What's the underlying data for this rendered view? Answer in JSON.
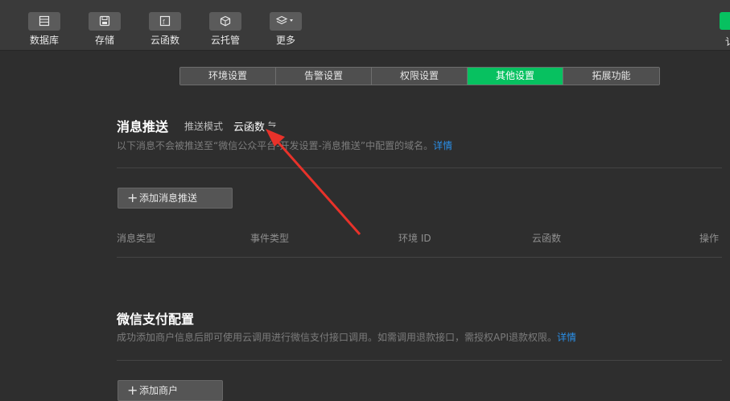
{
  "toolbar": {
    "items": [
      {
        "label": "数据库",
        "icon": "database-icon"
      },
      {
        "label": "存储",
        "icon": "storage-icon"
      },
      {
        "label": "云函数",
        "icon": "cloud-function-icon"
      },
      {
        "label": "云托管",
        "icon": "cloud-hosting-icon"
      },
      {
        "label": "更多",
        "icon": "more-layers-icon"
      }
    ],
    "edge_text": "讠"
  },
  "tabs": [
    {
      "label": "环境设置",
      "active": false
    },
    {
      "label": "告警设置",
      "active": false
    },
    {
      "label": "权限设置",
      "active": false
    },
    {
      "label": "其他设置",
      "active": true
    },
    {
      "label": "拓展功能",
      "active": false
    }
  ],
  "push": {
    "title": "消息推送",
    "mode_label": "推送模式",
    "mode_value": "云函数",
    "switch_glyph": "⇋",
    "desc": "以下消息不会被推送至“微信公众平台-开发设置-消息推送”中配置的域名。",
    "detail_link": "详情",
    "add_button": "添加消息推送",
    "columns": [
      "消息类型",
      "事件类型",
      "环境 ID",
      "云函数",
      "操作"
    ]
  },
  "pay": {
    "title": "微信支付配置",
    "desc": "成功添加商户信息后即可使用云调用进行微信支付接口调用。如需调用退款接口，需授权API退款权限。",
    "detail_link": "详情",
    "add_button": "添加商户"
  },
  "colors": {
    "accent": "#07c160",
    "link": "#2a8fe8",
    "arrow": "#e8322a",
    "background": "#2e2e2e"
  }
}
